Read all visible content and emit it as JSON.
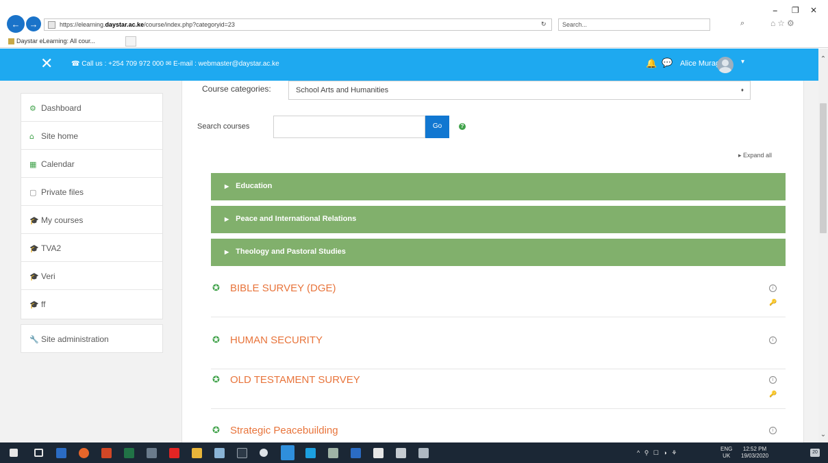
{
  "browser": {
    "address_prefix": "https://elearning.",
    "address_domain": "daystar.ac.ke",
    "address_path": "/course/index.php?categoryid=23",
    "refresh_glyph": "↻",
    "search_placeholder": "Search...",
    "search_glyph": "⌕",
    "tab_title": "Daystar eLearning: All cour...",
    "minimize_glyph": "–",
    "restore_glyph": "❐",
    "close_glyph": "✕",
    "back_glyph": "←",
    "forward_glyph": "→"
  },
  "topbar": {
    "menu_close_glyph": "✕",
    "contact": "☎ Call us : +254 709 972 000 ✉ E-mail : webmaster@daystar.ac.ke",
    "bell_glyph": "🔔",
    "chat_glyph": "💬",
    "user_name": "Alice Muraguri",
    "caret": "▾"
  },
  "sidebar": {
    "items": [
      {
        "label": "Dashboard",
        "icon": "dashboard-icon",
        "glyph": "⚙"
      },
      {
        "label": "Site home",
        "icon": "home-icon",
        "glyph": "⌂"
      },
      {
        "label": "Calendar",
        "icon": "calendar-icon",
        "glyph": "▦"
      },
      {
        "label": "Private files",
        "icon": "file-icon",
        "glyph": "▢"
      },
      {
        "label": "My courses",
        "icon": "mortarboard-icon",
        "glyph": "🎓"
      },
      {
        "label": "TVA2",
        "icon": "mortarboard-icon",
        "glyph": "🎓"
      },
      {
        "label": "Veri",
        "icon": "mortarboard-icon",
        "glyph": "🎓"
      },
      {
        "label": "ff",
        "icon": "mortarboard-icon",
        "glyph": "🎓"
      }
    ],
    "admin": {
      "label": "Site administration",
      "icon": "wrench-icon",
      "glyph": "🔧"
    }
  },
  "main": {
    "category_label": "Course categories:",
    "category_selected": "School Arts and Humanities",
    "select_caret": "♦",
    "search_label": "Search courses",
    "go_label": "Go",
    "help_glyph": "?",
    "expand_all": "▸ Expand all",
    "categories": [
      {
        "label": "Education"
      },
      {
        "label": "Peace and International Relations"
      },
      {
        "label": "Theology and Pastoral Studies"
      }
    ],
    "course_icon_glyph": "✪",
    "info_glyph": "i",
    "key_glyph": "🔑",
    "courses": [
      {
        "title": "BIBLE SURVEY (DGE)",
        "has_key": true
      },
      {
        "title": "HUMAN SECURITY",
        "has_key": false
      },
      {
        "title": "OLD TESTAMENT SURVEY",
        "has_key": true
      },
      {
        "title": "Strategic Peacebuilding",
        "has_key": false
      }
    ]
  },
  "taskbar": {
    "tray_icons": "^ ⚲ ☐ ◑ ⚘",
    "lang": "ENG\nUK",
    "time": "12:52 PM",
    "date": "19/03/2020",
    "notify": "20"
  },
  "colors": {
    "topbar": "#1ea9f0",
    "category_bar": "#81b06c",
    "course_title": "#e8743b",
    "go_button": "#1177d1",
    "taskbar": "#1b2735"
  }
}
